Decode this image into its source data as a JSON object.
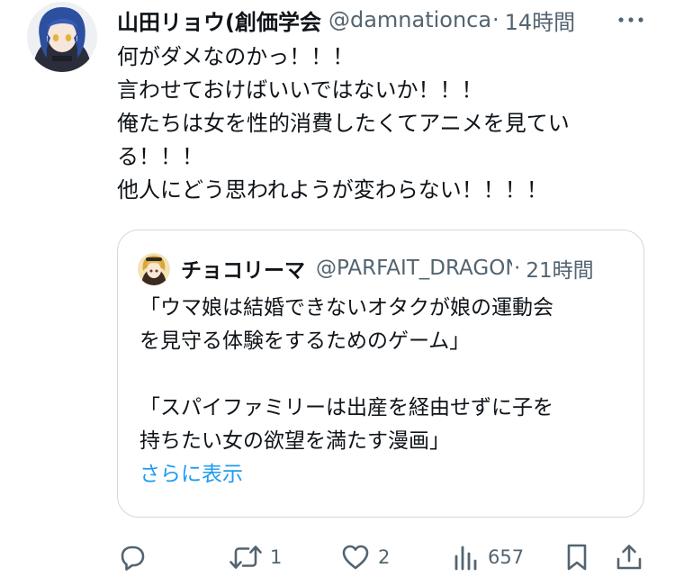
{
  "tweet": {
    "display_name": "山田リョウ(創価学会",
    "handle": "@damnationcam",
    "separator": "·",
    "time": "14時間",
    "avatar_icon": "user-avatar-icon",
    "lines": [
      "何がダメなのかっ！！！",
      "言わせておけばいいではないか！！！",
      "俺たちは女を性的消費したくてアニメを見てい",
      "る！！！",
      "他人にどう思われようが変わらない！！！！"
    ]
  },
  "quote": {
    "display_name": "チョコリーマ",
    "handle": "@PARFAIT_DRAGON",
    "separator": "·",
    "time": "21時間",
    "lines": [
      "「ウマ娘は結婚できないオタクが娘の運動会",
      "を見守る体験をするためのゲーム」",
      "",
      "「スパイファミリーは出産を経由せずに子を",
      "持ちたい女の欲望を満たす漫画」"
    ],
    "show_more": "さらに表示"
  },
  "actions": {
    "reply_count": "",
    "retweet_count": "1",
    "like_count": "2",
    "views_count": "657"
  },
  "colors": {
    "text": "#0f1419",
    "secondary": "#536471",
    "link": "#1d9bf0",
    "border": "#cfd9de"
  }
}
